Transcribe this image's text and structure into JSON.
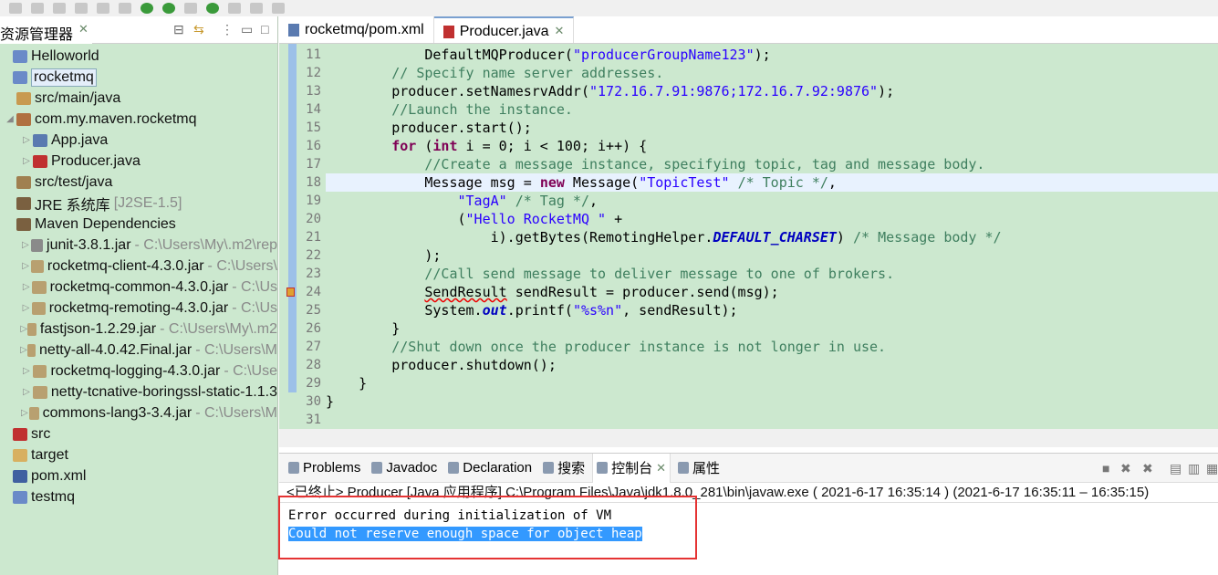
{
  "explorer": {
    "title": "资源管理器",
    "close": "✕",
    "items": [
      {
        "label": "Helloworld",
        "depth": 0,
        "twisty": "",
        "icon": "project-icon",
        "color": "#6a8ac8"
      },
      {
        "label": "rocketmq",
        "depth": 0,
        "twisty": "",
        "icon": "project-icon",
        "color": "#6a8ac8",
        "selected": true
      },
      {
        "label": "src/main/java",
        "depth": 1,
        "twisty": "",
        "icon": "source-folder-error-icon",
        "color": "#c89a50"
      },
      {
        "label": "com.my.maven.rocketmq",
        "depth": 1,
        "twisty": "◢",
        "icon": "package-error-icon",
        "color": "#b07040"
      },
      {
        "label": "App.java",
        "depth": 2,
        "twisty": "▷",
        "icon": "java-file-icon",
        "color": "#5a7ab0"
      },
      {
        "label": "Producer.java",
        "depth": 2,
        "twisty": "▷",
        "icon": "java-file-error-icon",
        "color": "#c03030"
      },
      {
        "label": "src/test/java",
        "depth": 1,
        "twisty": "",
        "icon": "source-folder-icon",
        "color": "#a08050"
      },
      {
        "label": "JRE 系统库",
        "path": "[J2SE-1.5]",
        "depth": 1,
        "twisty": "",
        "icon": "library-icon",
        "color": "#7a6040"
      },
      {
        "label": "Maven Dependencies",
        "depth": 1,
        "twisty": "",
        "icon": "library-icon",
        "color": "#7a6040"
      },
      {
        "label": "junit-3.8.1.jar",
        "path": "- C:\\Users\\My\\.m2\\rep",
        "depth": 2,
        "twisty": "▷",
        "icon": "jar-icon",
        "color": "#8a8a8a"
      },
      {
        "label": "rocketmq-client-4.3.0.jar",
        "path": "- C:\\Users\\",
        "depth": 2,
        "twisty": "▷",
        "icon": "jar-icon",
        "color": "#b8a070"
      },
      {
        "label": "rocketmq-common-4.3.0.jar",
        "path": "- C:\\Us",
        "depth": 2,
        "twisty": "▷",
        "icon": "jar-icon",
        "color": "#b8a070"
      },
      {
        "label": "rocketmq-remoting-4.3.0.jar",
        "path": "- C:\\Us",
        "depth": 2,
        "twisty": "▷",
        "icon": "jar-icon",
        "color": "#b8a070"
      },
      {
        "label": "fastjson-1.2.29.jar",
        "path": "- C:\\Users\\My\\.m2",
        "depth": 2,
        "twisty": "▷",
        "icon": "jar-icon",
        "color": "#b8a070"
      },
      {
        "label": "netty-all-4.0.42.Final.jar",
        "path": "- C:\\Users\\M",
        "depth": 2,
        "twisty": "▷",
        "icon": "jar-icon",
        "color": "#b8a070"
      },
      {
        "label": "rocketmq-logging-4.3.0.jar",
        "path": "- C:\\Use",
        "depth": 2,
        "twisty": "▷",
        "icon": "jar-icon",
        "color": "#b8a070"
      },
      {
        "label": "netty-tcnative-boringssl-static-1.1.3",
        "depth": 2,
        "twisty": "▷",
        "icon": "jar-icon",
        "color": "#b8a070"
      },
      {
        "label": "commons-lang3-3.4.jar",
        "path": "- C:\\Users\\M",
        "depth": 2,
        "twisty": "▷",
        "icon": "jar-icon",
        "color": "#b8a070"
      },
      {
        "label": "src",
        "depth": 0,
        "twisty": "",
        "icon": "folder-error-icon",
        "color": "#c03030"
      },
      {
        "label": "target",
        "depth": 0,
        "twisty": "",
        "icon": "folder-icon",
        "color": "#d8b060"
      },
      {
        "label": "pom.xml",
        "depth": 0,
        "twisty": "",
        "icon": "xml-file-icon",
        "color": "#4060a0"
      },
      {
        "label": "testmq",
        "depth": 0,
        "twisty": "",
        "icon": "project-icon",
        "color": "#6a8ac8"
      }
    ]
  },
  "editor": {
    "tabs": [
      {
        "label": "rocketmq/pom.xml",
        "active": false
      },
      {
        "label": "Producer.java",
        "active": true,
        "close": "✕"
      }
    ],
    "current_line": 18,
    "lines": [
      {
        "n": "11",
        "t": [
          [
            "t",
            "            DefaultMQProducer("
          ],
          [
            "s",
            "\"producerGroupName123\""
          ],
          [
            "t",
            ");"
          ]
        ]
      },
      {
        "n": "12",
        "t": [
          [
            "c",
            "        // Specify name server addresses."
          ]
        ]
      },
      {
        "n": "13",
        "t": [
          [
            "t",
            "        producer.setNamesrvAddr("
          ],
          [
            "s",
            "\"172.16.7.91:9876;172.16.7.92:9876\""
          ],
          [
            "t",
            ");"
          ]
        ]
      },
      {
        "n": "14",
        "t": [
          [
            "c",
            "        //Launch the instance."
          ]
        ]
      },
      {
        "n": "15",
        "t": [
          [
            "t",
            "        producer.start();"
          ]
        ]
      },
      {
        "n": "16",
        "t": [
          [
            "t",
            "        "
          ],
          [
            "k",
            "for"
          ],
          [
            "t",
            " ("
          ],
          [
            "k",
            "int"
          ],
          [
            "t",
            " i = 0; i < 100; i++) {"
          ]
        ]
      },
      {
        "n": "17",
        "t": [
          [
            "c",
            "            //Create a message instance, specifying topic, tag and message body."
          ]
        ]
      },
      {
        "n": "18",
        "t": [
          [
            "t",
            "            Message msg = "
          ],
          [
            "k",
            "new"
          ],
          [
            "t",
            " Message("
          ],
          [
            "s",
            "\"TopicTest\""
          ],
          [
            "t",
            " "
          ],
          [
            "c",
            "/* Topic */"
          ],
          [
            "t",
            ","
          ]
        ]
      },
      {
        "n": "19",
        "t": [
          [
            "t",
            "                "
          ],
          [
            "s",
            "\"TagA\""
          ],
          [
            "t",
            " "
          ],
          [
            "c",
            "/* Tag */"
          ],
          [
            "t",
            ","
          ]
        ]
      },
      {
        "n": "20",
        "t": [
          [
            "t",
            "                ("
          ],
          [
            "s",
            "\"Hello RocketMQ \""
          ],
          [
            "t",
            " +"
          ]
        ]
      },
      {
        "n": "21",
        "t": [
          [
            "t",
            "                    i).getBytes(RemotingHelper."
          ],
          [
            "f",
            "DEFAULT_CHARSET"
          ],
          [
            "t",
            ") "
          ],
          [
            "c",
            "/* Message body */"
          ]
        ]
      },
      {
        "n": "22",
        "t": [
          [
            "t",
            "            );"
          ]
        ]
      },
      {
        "n": "23",
        "t": [
          [
            "c",
            "            //Call send message to deliver message to one of brokers."
          ]
        ]
      },
      {
        "n": "24",
        "t": [
          [
            "t",
            "            "
          ],
          [
            "q",
            "SendResult"
          ],
          [
            "t",
            " sendResult = producer.send(msg);"
          ]
        ],
        "marker": true
      },
      {
        "n": "25",
        "t": [
          [
            "t",
            "            System."
          ],
          [
            "f",
            "out"
          ],
          [
            "t",
            ".printf("
          ],
          [
            "s",
            "\"%s%n\""
          ],
          [
            "t",
            ", sendResult);"
          ]
        ]
      },
      {
        "n": "26",
        "t": [
          [
            "t",
            "        }"
          ]
        ]
      },
      {
        "n": "27",
        "t": [
          [
            "c",
            "        //Shut down once the producer instance is not longer in use."
          ]
        ]
      },
      {
        "n": "28",
        "t": [
          [
            "t",
            "        producer.shutdown();"
          ]
        ]
      },
      {
        "n": "29",
        "t": [
          [
            "t",
            "    }"
          ]
        ]
      },
      {
        "n": "30",
        "t": [
          [
            "t",
            "}"
          ]
        ]
      },
      {
        "n": "31",
        "t": [
          [
            "t",
            ""
          ]
        ]
      }
    ]
  },
  "bottom": {
    "tabs": [
      {
        "label": "Problems",
        "icon": "problems-icon"
      },
      {
        "label": "Javadoc",
        "icon": "at-icon"
      },
      {
        "label": "Declaration",
        "icon": "declaration-icon"
      },
      {
        "label": "搜索",
        "icon": "search-icon"
      },
      {
        "label": "控制台",
        "icon": "console-icon",
        "active": true,
        "close": "✕"
      },
      {
        "label": "属性",
        "icon": "properties-icon"
      }
    ],
    "console_header": "<已终止> Producer [Java 应用程序] C:\\Program Files\\Java\\jdk1.8.0_281\\bin\\javaw.exe ( 2021-6-17 16:35:14 )  (2021-6-17 16:35:11 – 16:35:15)",
    "output": [
      "Error occurred during initialization of VM",
      "Could not reserve enough space for object heap"
    ]
  },
  "colors": {
    "tree_bg": "#cce8cf",
    "selection": "#3399ff",
    "annotation": "#e53333"
  }
}
